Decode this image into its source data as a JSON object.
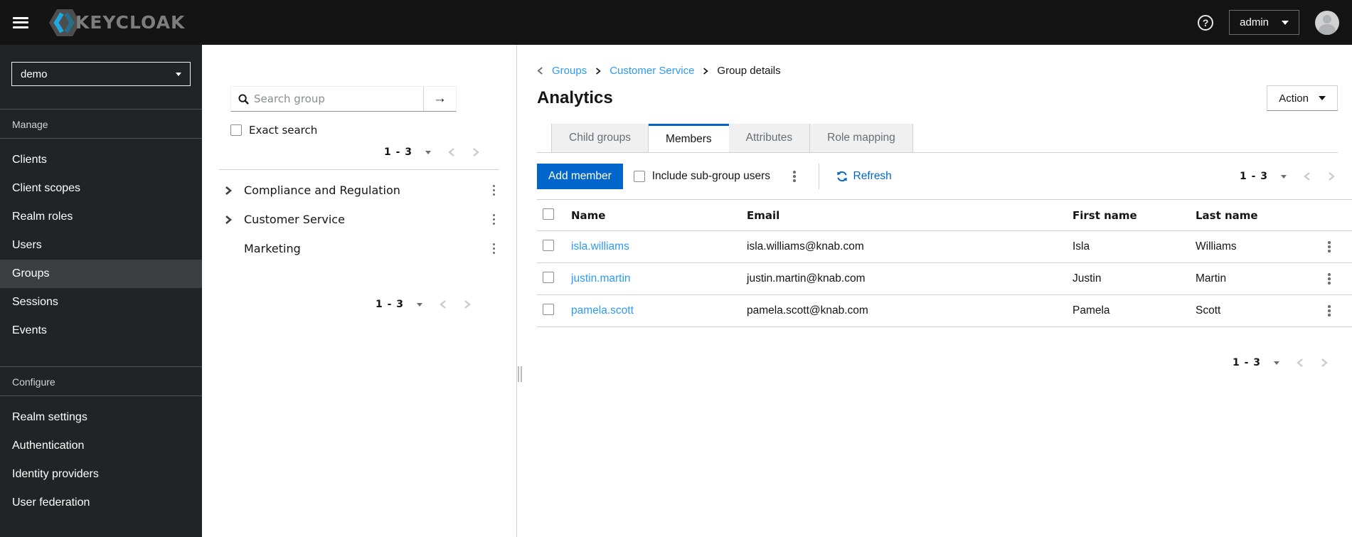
{
  "topbar": {
    "brand": "KEYCLOAK",
    "user_menu": "admin"
  },
  "sidebar": {
    "realm": "demo",
    "sections": [
      {
        "label": "Manage",
        "items": [
          "Clients",
          "Client scopes",
          "Realm roles",
          "Users",
          "Groups",
          "Sessions",
          "Events"
        ],
        "selected_item": "Groups"
      },
      {
        "label": "Configure",
        "items": [
          "Realm settings",
          "Authentication",
          "Identity providers",
          "User federation"
        ]
      }
    ]
  },
  "tree_panel": {
    "search": {
      "placeholder": "Search group"
    },
    "exact_search_label": "Exact search",
    "pagination_top": "1 - 3",
    "pagination_bottom": "1 - 3",
    "groups": [
      {
        "name": "Compliance and Regulation",
        "expandable": true
      },
      {
        "name": "Customer Service",
        "expandable": true
      },
      {
        "name": "Marketing",
        "expandable": false
      }
    ]
  },
  "main": {
    "breadcrumb": {
      "items": [
        "Groups",
        "Customer Service",
        "Group details"
      ]
    },
    "title": "Analytics",
    "action_button": "Action",
    "tabs": [
      {
        "label": "Child groups",
        "active": false
      },
      {
        "label": "Members",
        "active": true
      },
      {
        "label": "Attributes",
        "active": false
      },
      {
        "label": "Role mapping",
        "active": false
      }
    ],
    "toolbar": {
      "add_member_label": "Add member",
      "include_subgroups_label": "Include sub-group users",
      "refresh_label": "Refresh",
      "pagination": "1 - 3"
    },
    "table": {
      "headers": {
        "name": "Name",
        "email": "Email",
        "first": "First name",
        "last": "Last name"
      },
      "rows": [
        {
          "name": "isla.williams",
          "email": "isla.williams@knab.com",
          "first": "Isla",
          "last": "Williams"
        },
        {
          "name": "justin.martin",
          "email": "justin.martin@knab.com",
          "first": "Justin",
          "last": "Martin"
        },
        {
          "name": "pamela.scott",
          "email": "pamela.scott@knab.com",
          "first": "Pamela",
          "last": "Scott"
        }
      ]
    },
    "pagination_bottom": "1 - 3"
  },
  "colors": {
    "topbar_bg": "#141414",
    "sidebar_bg": "#212427",
    "sidebar_selected_bg": "#3c3f42",
    "accent_blue": "#0066cc",
    "link_blue": "#2b9af3",
    "border_gray": "#d2d2d2",
    "muted_text": "#6a6e73"
  }
}
